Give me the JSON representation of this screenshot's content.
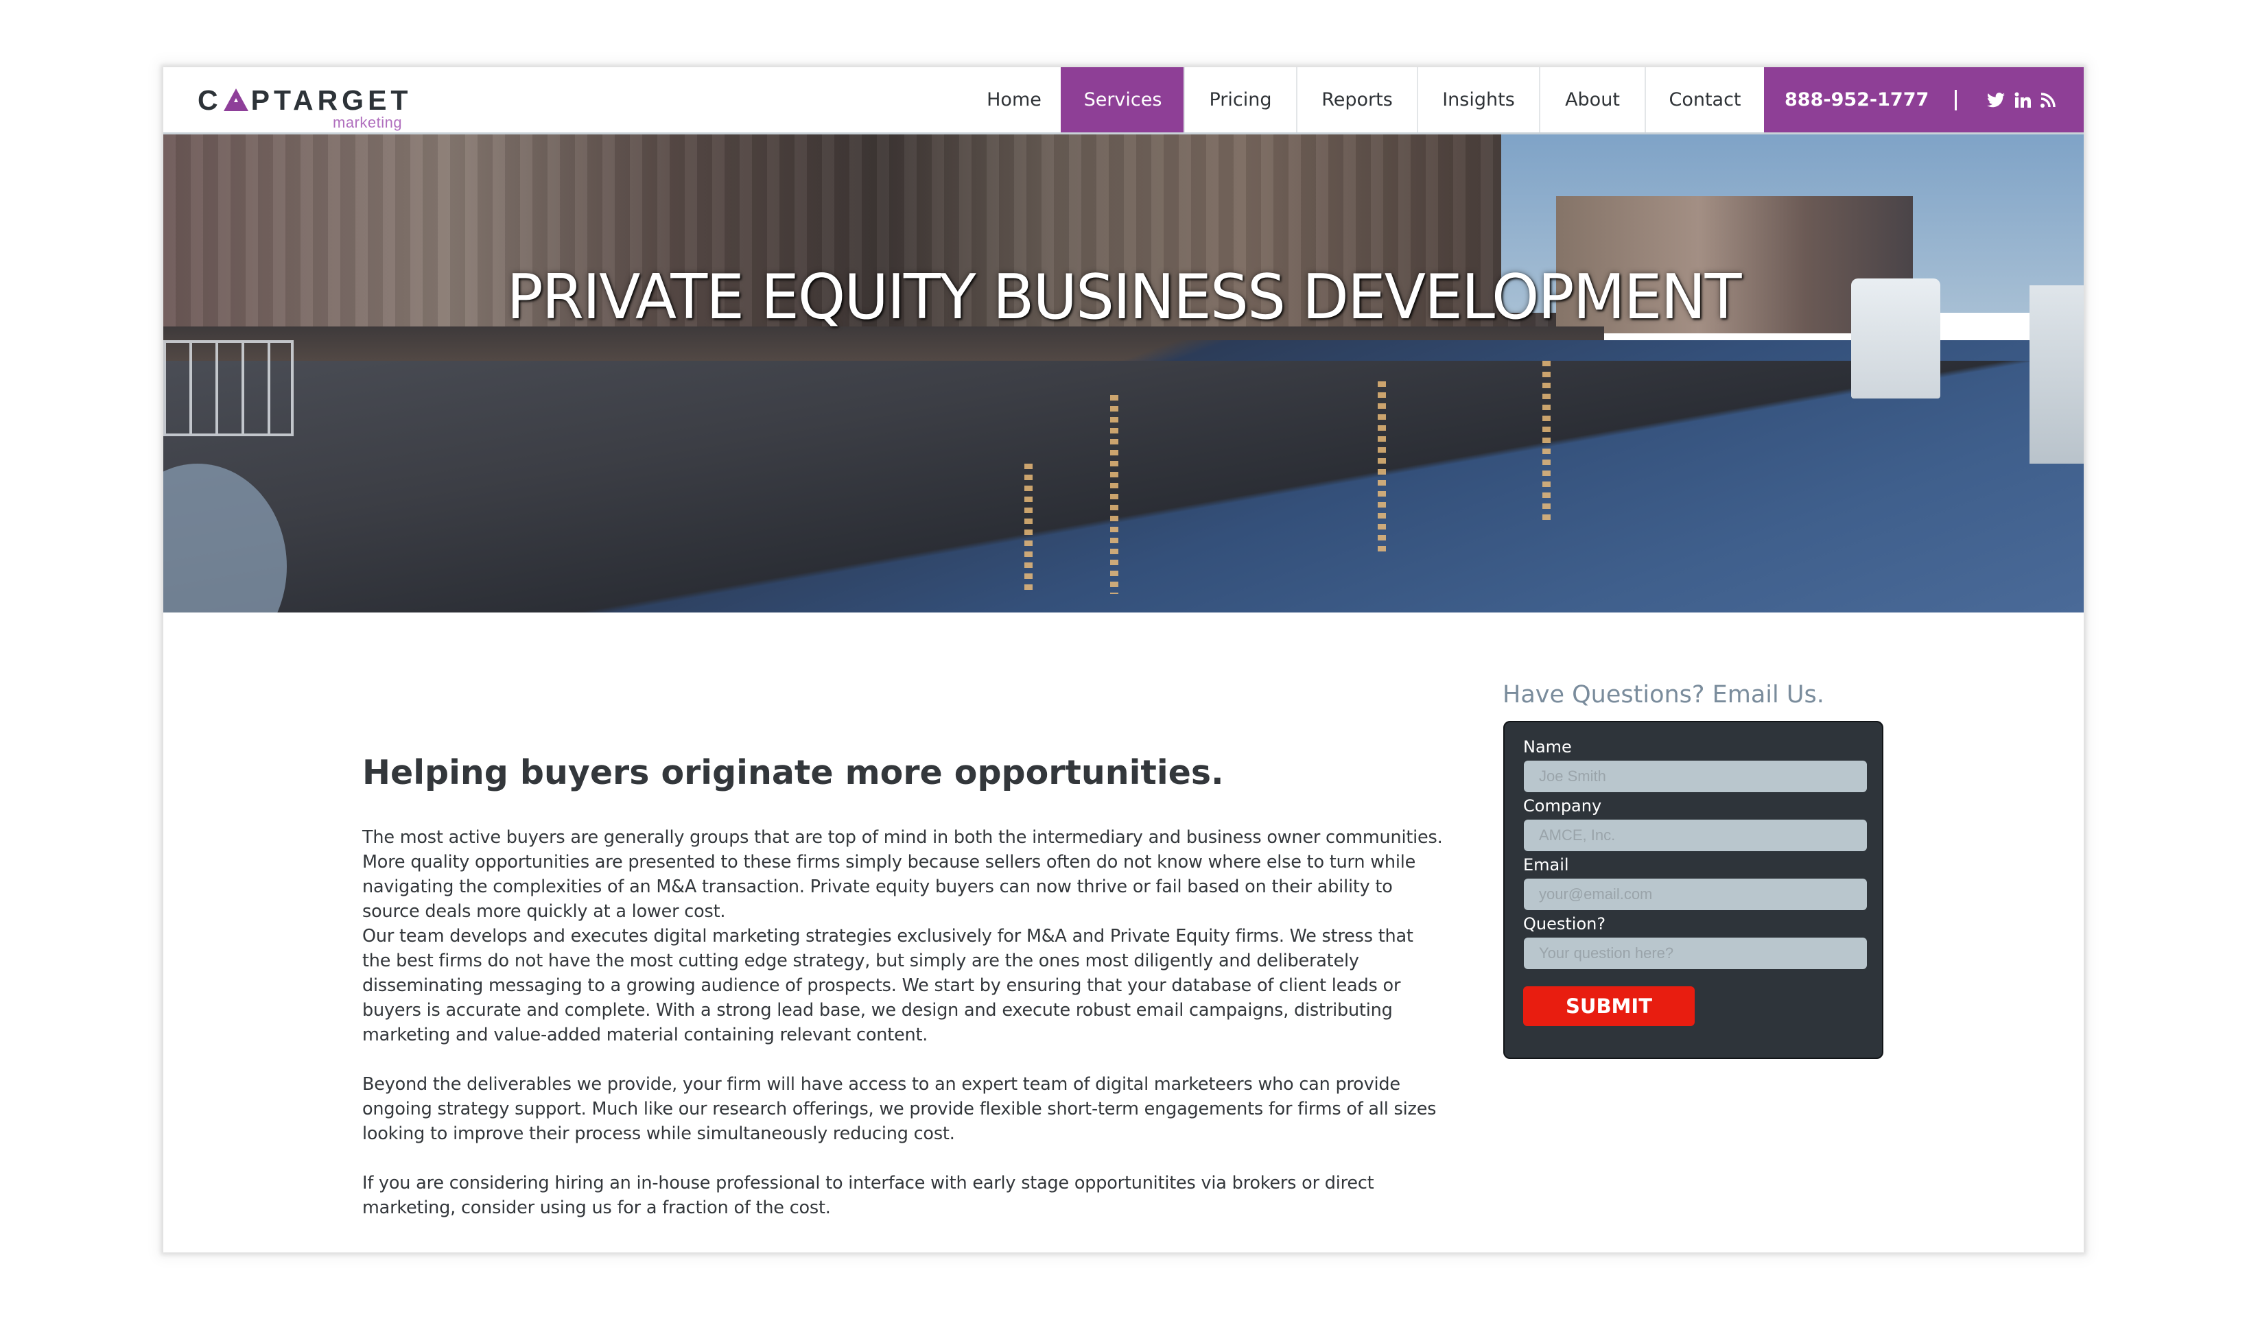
{
  "brand": {
    "name_pre": "C",
    "name_post": "PTARGET",
    "tagline": "marketing",
    "accent_color": "#8e3f96"
  },
  "nav": {
    "items": [
      {
        "label": "Home",
        "active": false
      },
      {
        "label": "Services",
        "active": true
      },
      {
        "label": "Pricing",
        "active": false
      },
      {
        "label": "Reports",
        "active": false
      },
      {
        "label": "Insights",
        "active": false
      },
      {
        "label": "About",
        "active": false
      },
      {
        "label": "Contact",
        "active": false
      }
    ],
    "phone": "888-952-1777",
    "separator": "|",
    "social_icons": [
      "twitter-icon",
      "linkedin-icon",
      "rss-icon"
    ]
  },
  "hero": {
    "title": "PRIVATE EQUITY BUSINESS DEVELOPMENT"
  },
  "main": {
    "headline": "Helping buyers originate more opportunities.",
    "paragraphs": [
      "The most active buyers are generally groups that are top of mind in both the intermediary and business owner communities.  More quality opportunities are presented to these firms simply because sellers often do not know where else to turn while navigating the complexities of an M&A transaction. Private equity buyers can now thrive or fail based on their ability to source deals more quickly at a lower cost.",
      "Our team develops and executes digital marketing strategies exclusively for M&A and Private Equity firms.  We stress that the best firms do not have the most cutting edge strategy, but simply are the ones most diligently and deliberately disseminating messaging to a growing audience of prospects.  We start by ensuring that your database of client leads or buyers is accurate and complete. With a strong lead base, we design and execute robust email campaigns, distributing marketing and value-added material containing relevant content.",
      "Beyond the deliverables we provide, your firm will have access to an expert team of digital marketeers who can provide ongoing strategy support.  Much like our research offerings, we provide flexible short-term engagements for firms of all sizes looking to improve their process while simultaneously reducing cost.",
      "If you are considering hiring an in-house professional to interface with early stage opportunitites via brokers or direct marketing, consider using us for a fraction of the cost."
    ]
  },
  "sidebar": {
    "title": "Have Questions? Email Us.",
    "form": {
      "fields": [
        {
          "label": "Name",
          "placeholder": "Joe Smith",
          "value": ""
        },
        {
          "label": "Company",
          "placeholder": "AMCE, Inc.",
          "value": ""
        },
        {
          "label": "Email",
          "placeholder": "your@email.com",
          "value": ""
        },
        {
          "label": "Question?",
          "placeholder": "Your question here?",
          "value": ""
        }
      ],
      "submit_label": "SUBMIT",
      "submit_color": "#e81d10"
    }
  }
}
